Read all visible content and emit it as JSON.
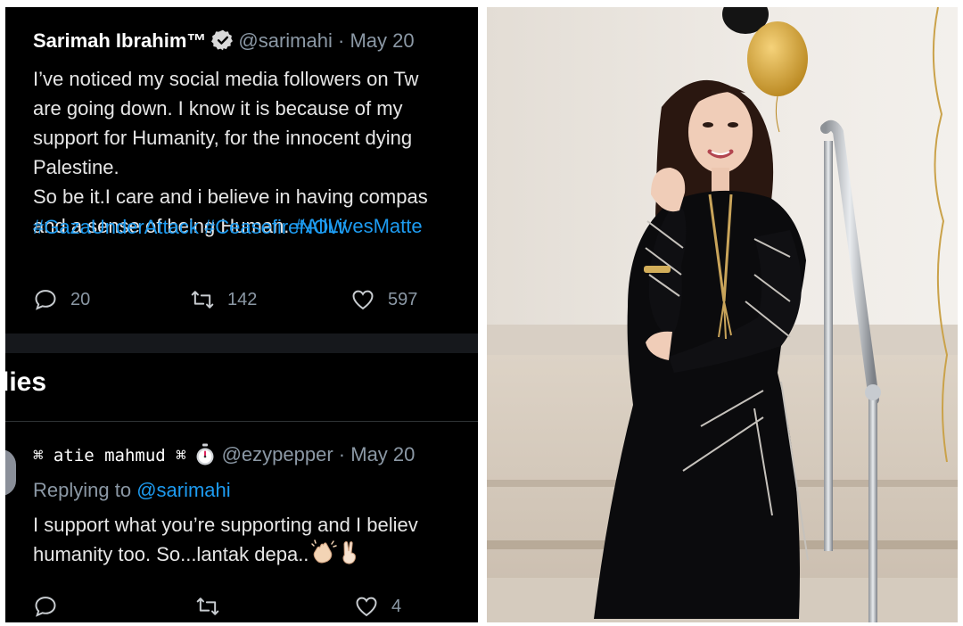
{
  "tweet": {
    "display_name": "Sarimah Ibrahim™",
    "handle": "@sarimahi",
    "separator": "·",
    "date": "May 20",
    "body": "I’ve noticed my social media followers on Tw\nare going down. I know it is because of my\nsupport for Humanity, for the innocent dying\nPalestine.\nSo be it.I care and i believe in having compas\nand a sense of being Human. ",
    "hashtag_inline": "#AllLivesMatte",
    "hashtags": [
      "#GazaUnderAttack",
      "#CeasefireNOW"
    ],
    "replies_count": "20",
    "retweets_count": "142",
    "likes_count": "597"
  },
  "replies_section": {
    "heading": "lies"
  },
  "reply": {
    "display_name": "⌘ atie mahmud ⌘",
    "handle": "@ezypepper",
    "separator": "·",
    "date": "May 20",
    "replying_prefix": "Replying to ",
    "replying_to": "@sarimahi",
    "body": "I support what you’re supporting and I believ\nhumanity too. So...lantak depa..",
    "likes_count": "4"
  },
  "colors": {
    "background": "#000000",
    "text": "#e6e6e6",
    "muted": "#8b98a5",
    "link": "#1d9bf0",
    "verified": "#d9d9d9"
  },
  "icons": [
    "verified-badge-icon",
    "reply-icon",
    "retweet-icon",
    "like-icon",
    "stopwatch-icon",
    "clapping-hands-icon",
    "victory-hand-icon"
  ]
}
